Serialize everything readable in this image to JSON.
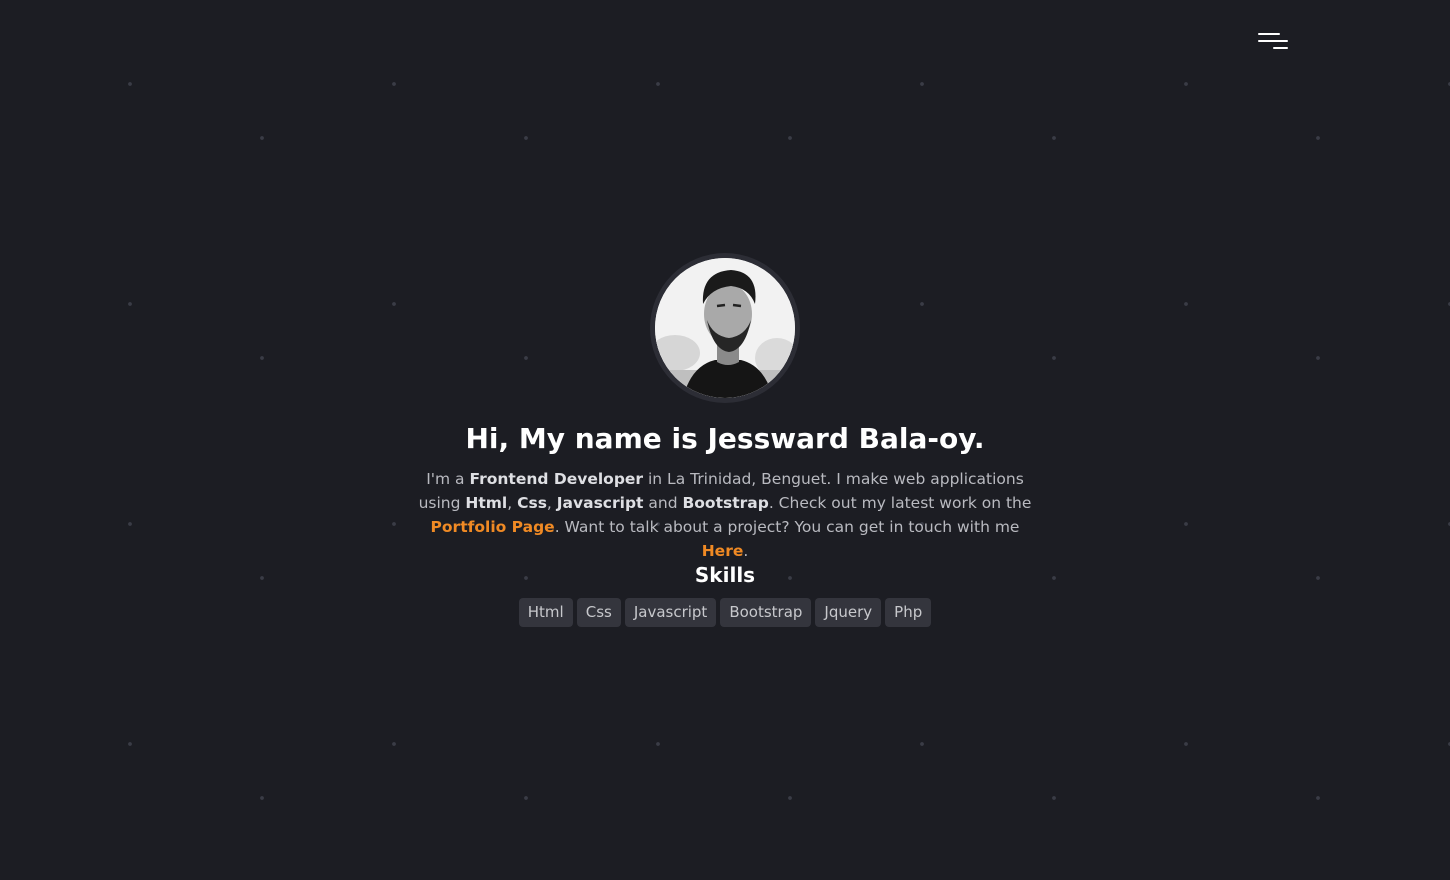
{
  "menu": {
    "icon": "hamburger-menu-icon"
  },
  "profile": {
    "image_name": "avatar"
  },
  "hero": {
    "title": "Hi, My name is Jessward Bala-oy."
  },
  "intro": {
    "p1": "I'm a ",
    "role": "Frontend Developer",
    "p2": " in La Trinidad, Benguet. I make web applications using ",
    "tech1": "Html",
    "sep1": ", ",
    "tech2": "Css",
    "sep2": ", ",
    "tech3": "Javascript",
    "p3": " and ",
    "tech4": "Bootstrap",
    "p4": ". Check out my latest work on the ",
    "portfolio_link": "Portfolio Page",
    "p5": ". Want to talk about a project? You can get in touch with me ",
    "here_link": "Here",
    "p6": "."
  },
  "skills": {
    "title": "Skills",
    "items": [
      "Html",
      "Css",
      "Javascript",
      "Bootstrap",
      "Jquery",
      "Php"
    ]
  },
  "colors": {
    "background": "#1c1d23",
    "accent": "#f08a24",
    "badge_bg": "#34353d",
    "text_muted": "#b9bac0"
  }
}
